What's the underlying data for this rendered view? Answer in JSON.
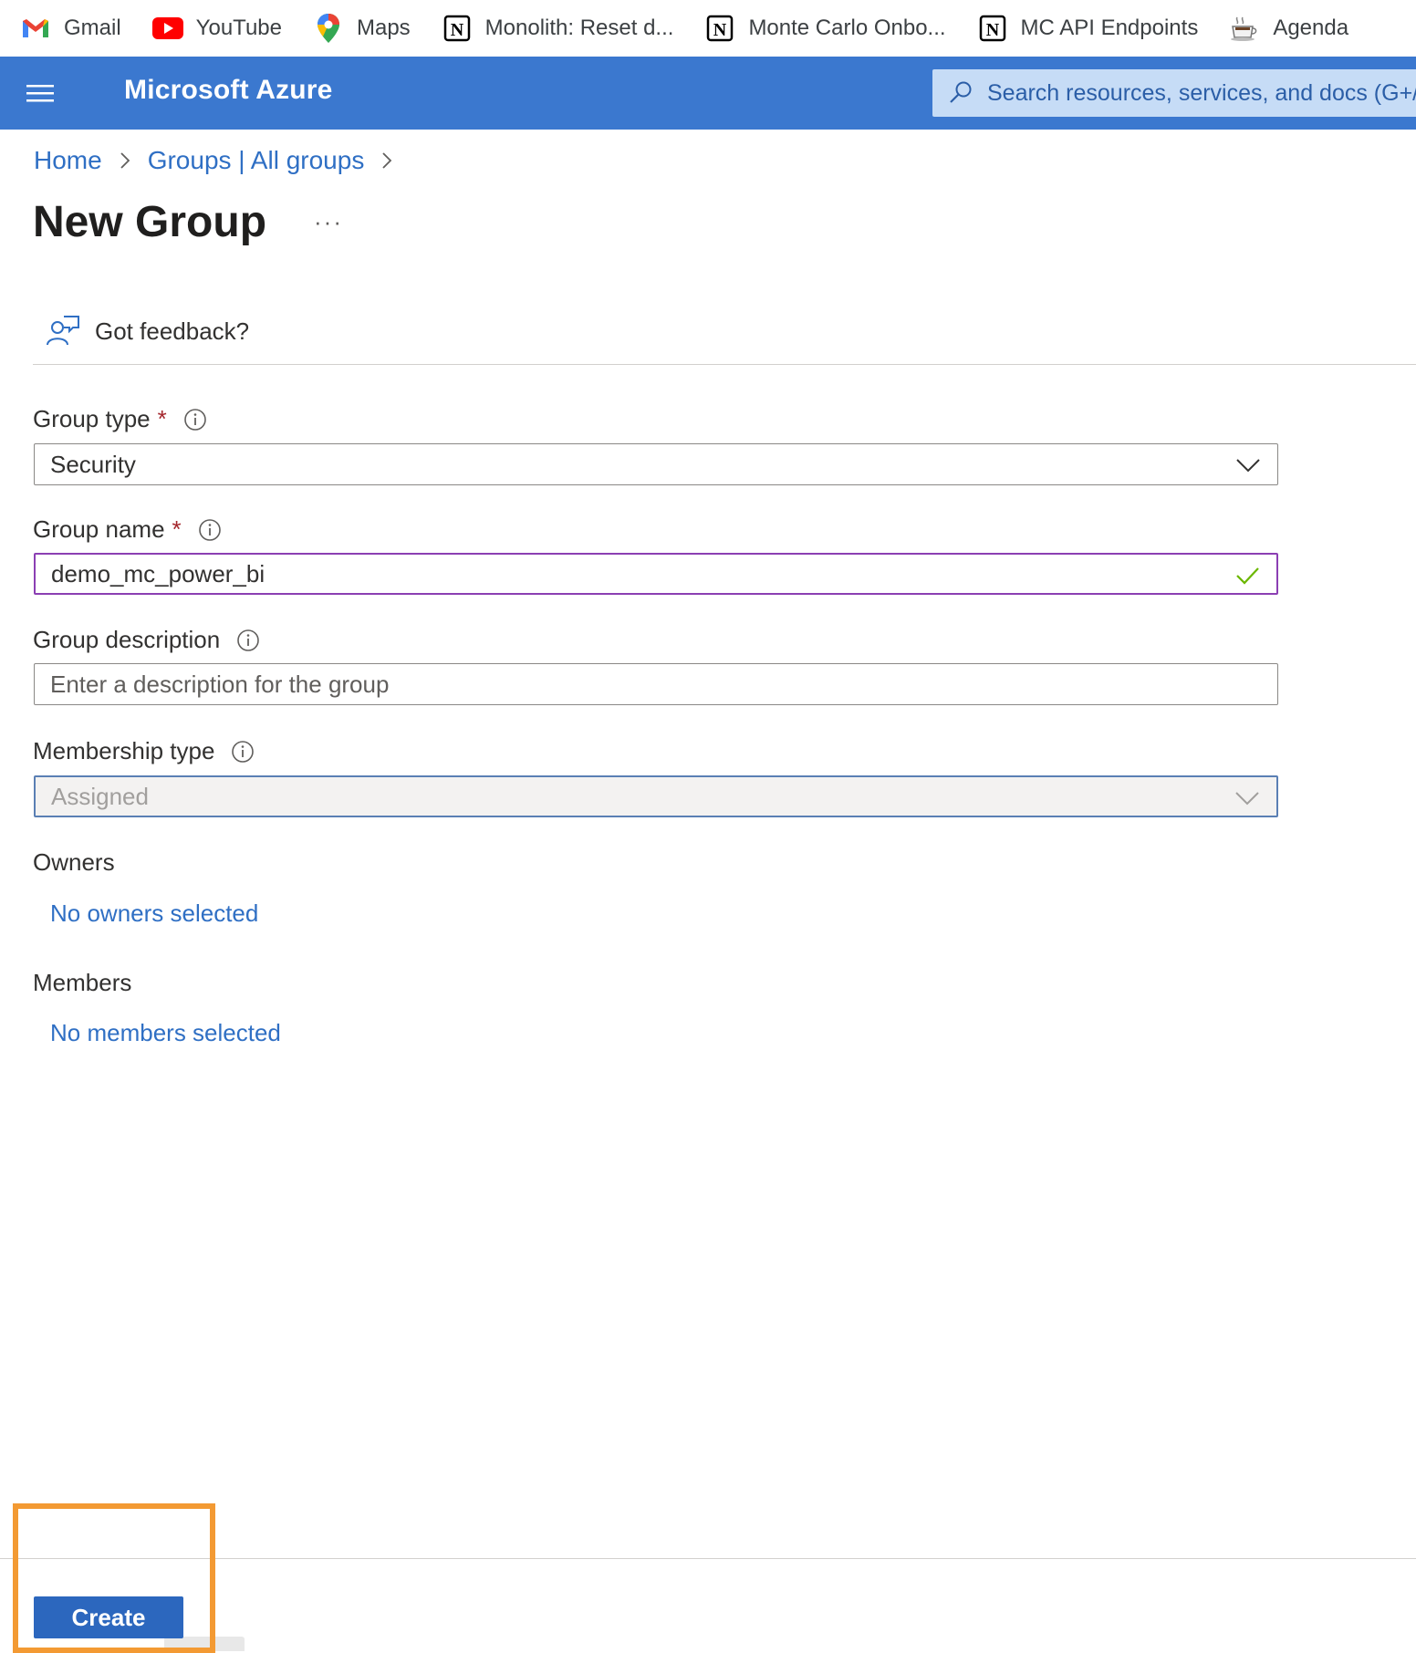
{
  "bookmarks": [
    {
      "label": "Gmail",
      "icon": "gmail-icon"
    },
    {
      "label": "YouTube",
      "icon": "youtube-icon"
    },
    {
      "label": "Maps",
      "icon": "maps-pin-icon"
    },
    {
      "label": "Monolith: Reset d...",
      "icon": "notion-icon"
    },
    {
      "label": "Monte Carlo Onbo...",
      "icon": "notion-icon"
    },
    {
      "label": "MC API Endpoints",
      "icon": "notion-icon"
    },
    {
      "label": "Agenda",
      "icon": "coffee-cup-icon"
    }
  ],
  "header": {
    "brand": "Microsoft Azure",
    "search_placeholder": "Search resources, services, and docs (G+/)"
  },
  "breadcrumb": {
    "items": [
      "Home",
      "Groups | All groups"
    ]
  },
  "page": {
    "title": "New Group",
    "more_label": "···",
    "feedback_label": "Got feedback?"
  },
  "form": {
    "group_type": {
      "label": "Group type",
      "required": "*",
      "value": "Security"
    },
    "group_name": {
      "label": "Group name",
      "required": "*",
      "value": "demo_mc_power_bi"
    },
    "group_description": {
      "label": "Group description",
      "placeholder": "Enter a description for the group"
    },
    "membership_type": {
      "label": "Membership type",
      "value": "Assigned"
    },
    "owners": {
      "label": "Owners",
      "link": "No owners selected"
    },
    "members": {
      "label": "Members",
      "link": "No members selected"
    }
  },
  "footer": {
    "create_label": "Create"
  },
  "colors": {
    "azure_header": "#3b78cf",
    "link": "#2f6fc4",
    "required": "#a4262c",
    "focus_border": "#8b3fb3",
    "valid_check": "#6bb700",
    "highlight": "#f39a33",
    "primary_button": "#2c67be"
  }
}
